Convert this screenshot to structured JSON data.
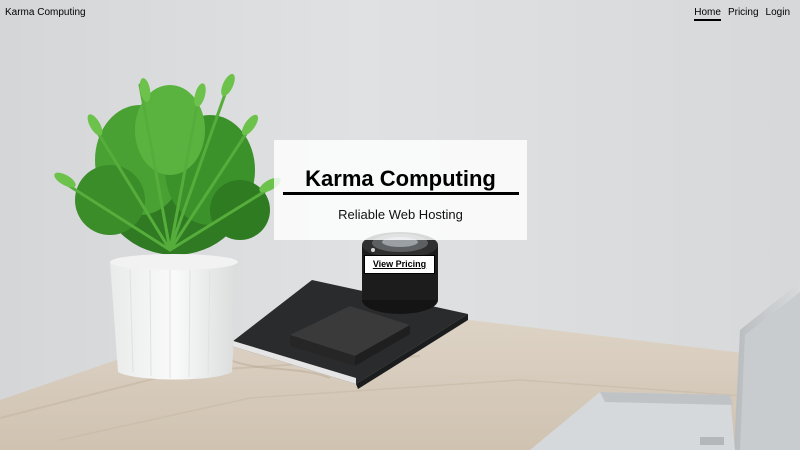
{
  "header": {
    "brand": "Karma Computing",
    "nav": [
      {
        "label": "Home",
        "active": true
      },
      {
        "label": "Pricing",
        "active": false
      },
      {
        "label": "Login",
        "active": false
      }
    ]
  },
  "hero": {
    "title": "Karma Computing",
    "tagline": "Reliable Web Hosting",
    "cta_label": "View Pricing",
    "background_image": "desk-with-plant-and-laptop-photo"
  },
  "colors": {
    "wall": "#d9dbdc",
    "desk": "#d8ccbc",
    "text": "#000000",
    "card_background": "#ffffff"
  }
}
